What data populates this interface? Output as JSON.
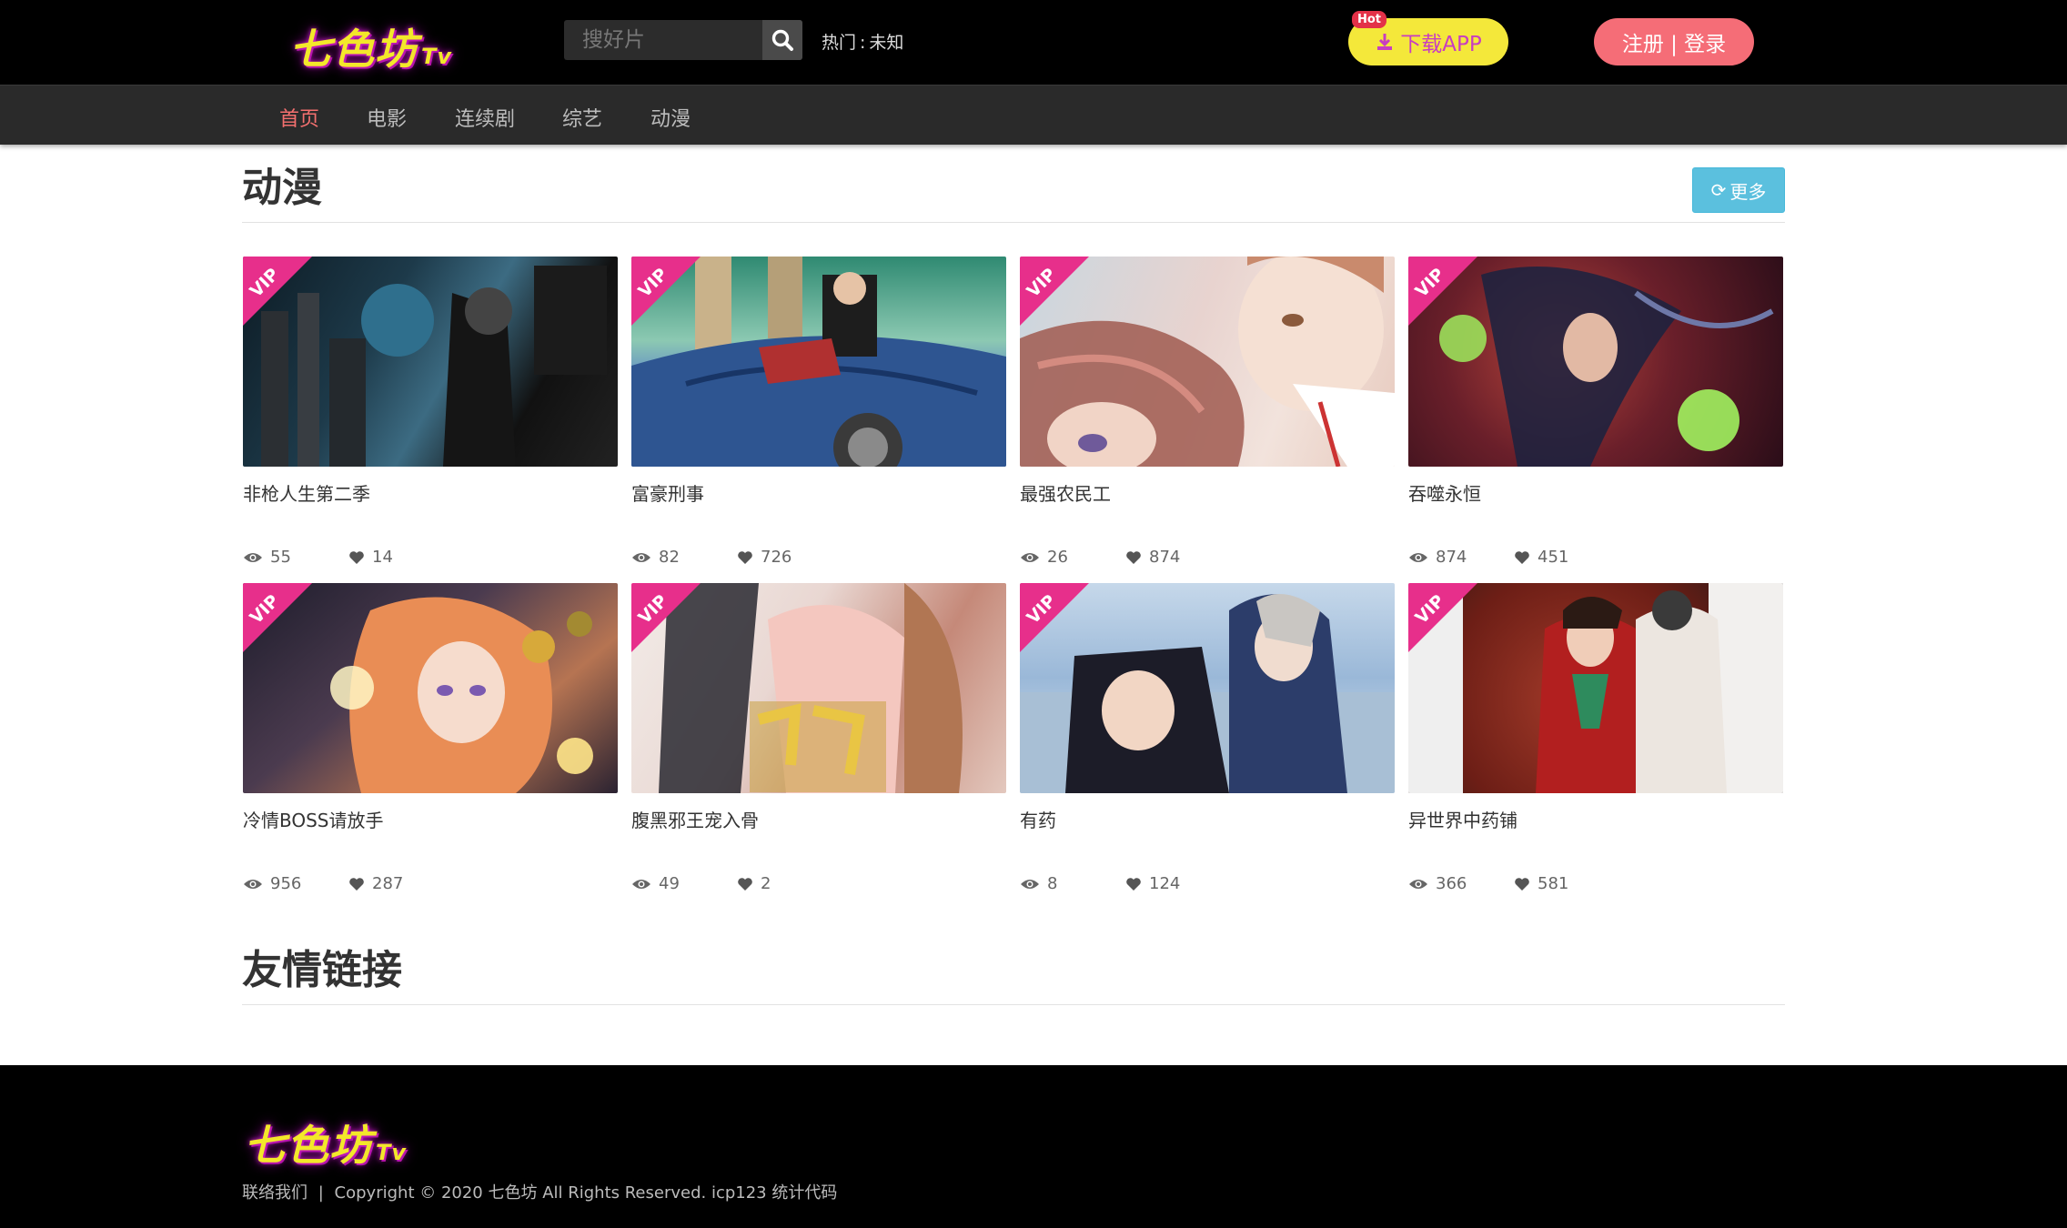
{
  "header": {
    "logo_text": "七色坊",
    "logo_suffix": "Tv",
    "search_placeholder": "搜好片",
    "hot_label": "热门",
    "hot_sep": ":",
    "hot_value": "未知",
    "hot_badge": "Hot",
    "download_label": "下载APP",
    "login_label": "注册 | 登录"
  },
  "nav": {
    "items": [
      {
        "label": "首页",
        "active": true
      },
      {
        "label": "电影"
      },
      {
        "label": "连续剧"
      },
      {
        "label": "综艺"
      },
      {
        "label": "动漫"
      }
    ]
  },
  "section": {
    "title": "动漫",
    "more_label": "更多"
  },
  "cards": [
    {
      "title": "非枪人生第二季",
      "views": "55",
      "likes": "14",
      "badge": "VIP"
    },
    {
      "title": "富豪刑事",
      "views": "82",
      "likes": "726",
      "badge": "VIP"
    },
    {
      "title": "最强农民工",
      "views": "26",
      "likes": "874",
      "badge": "VIP"
    },
    {
      "title": "吞噬永恒",
      "views": "874",
      "likes": "451",
      "badge": "VIP"
    },
    {
      "title": "冷情BOSS请放手",
      "views": "956",
      "likes": "287",
      "badge": "VIP"
    },
    {
      "title": "腹黑邪王宠入骨",
      "views": "49",
      "likes": "2",
      "badge": "VIP"
    },
    {
      "title": "有药",
      "views": "8",
      "likes": "124",
      "badge": "VIP"
    },
    {
      "title": "异世界中药铺",
      "views": "366",
      "likes": "581",
      "badge": "VIP"
    }
  ],
  "links_section": {
    "title": "友情链接"
  },
  "footer": {
    "logo_text": "七色坊",
    "logo_suffix": "Tv",
    "contact": "联络我们",
    "divider": "|",
    "copyright": "Copyright © 2020 七色坊 All Rights Reserved. icp123 统计代码"
  },
  "colors": {
    "accent_pink": "#f56d77",
    "download_yellow": "#f4e83a",
    "vip_badge": "#e72f8b",
    "more_button": "#5bc0de"
  }
}
